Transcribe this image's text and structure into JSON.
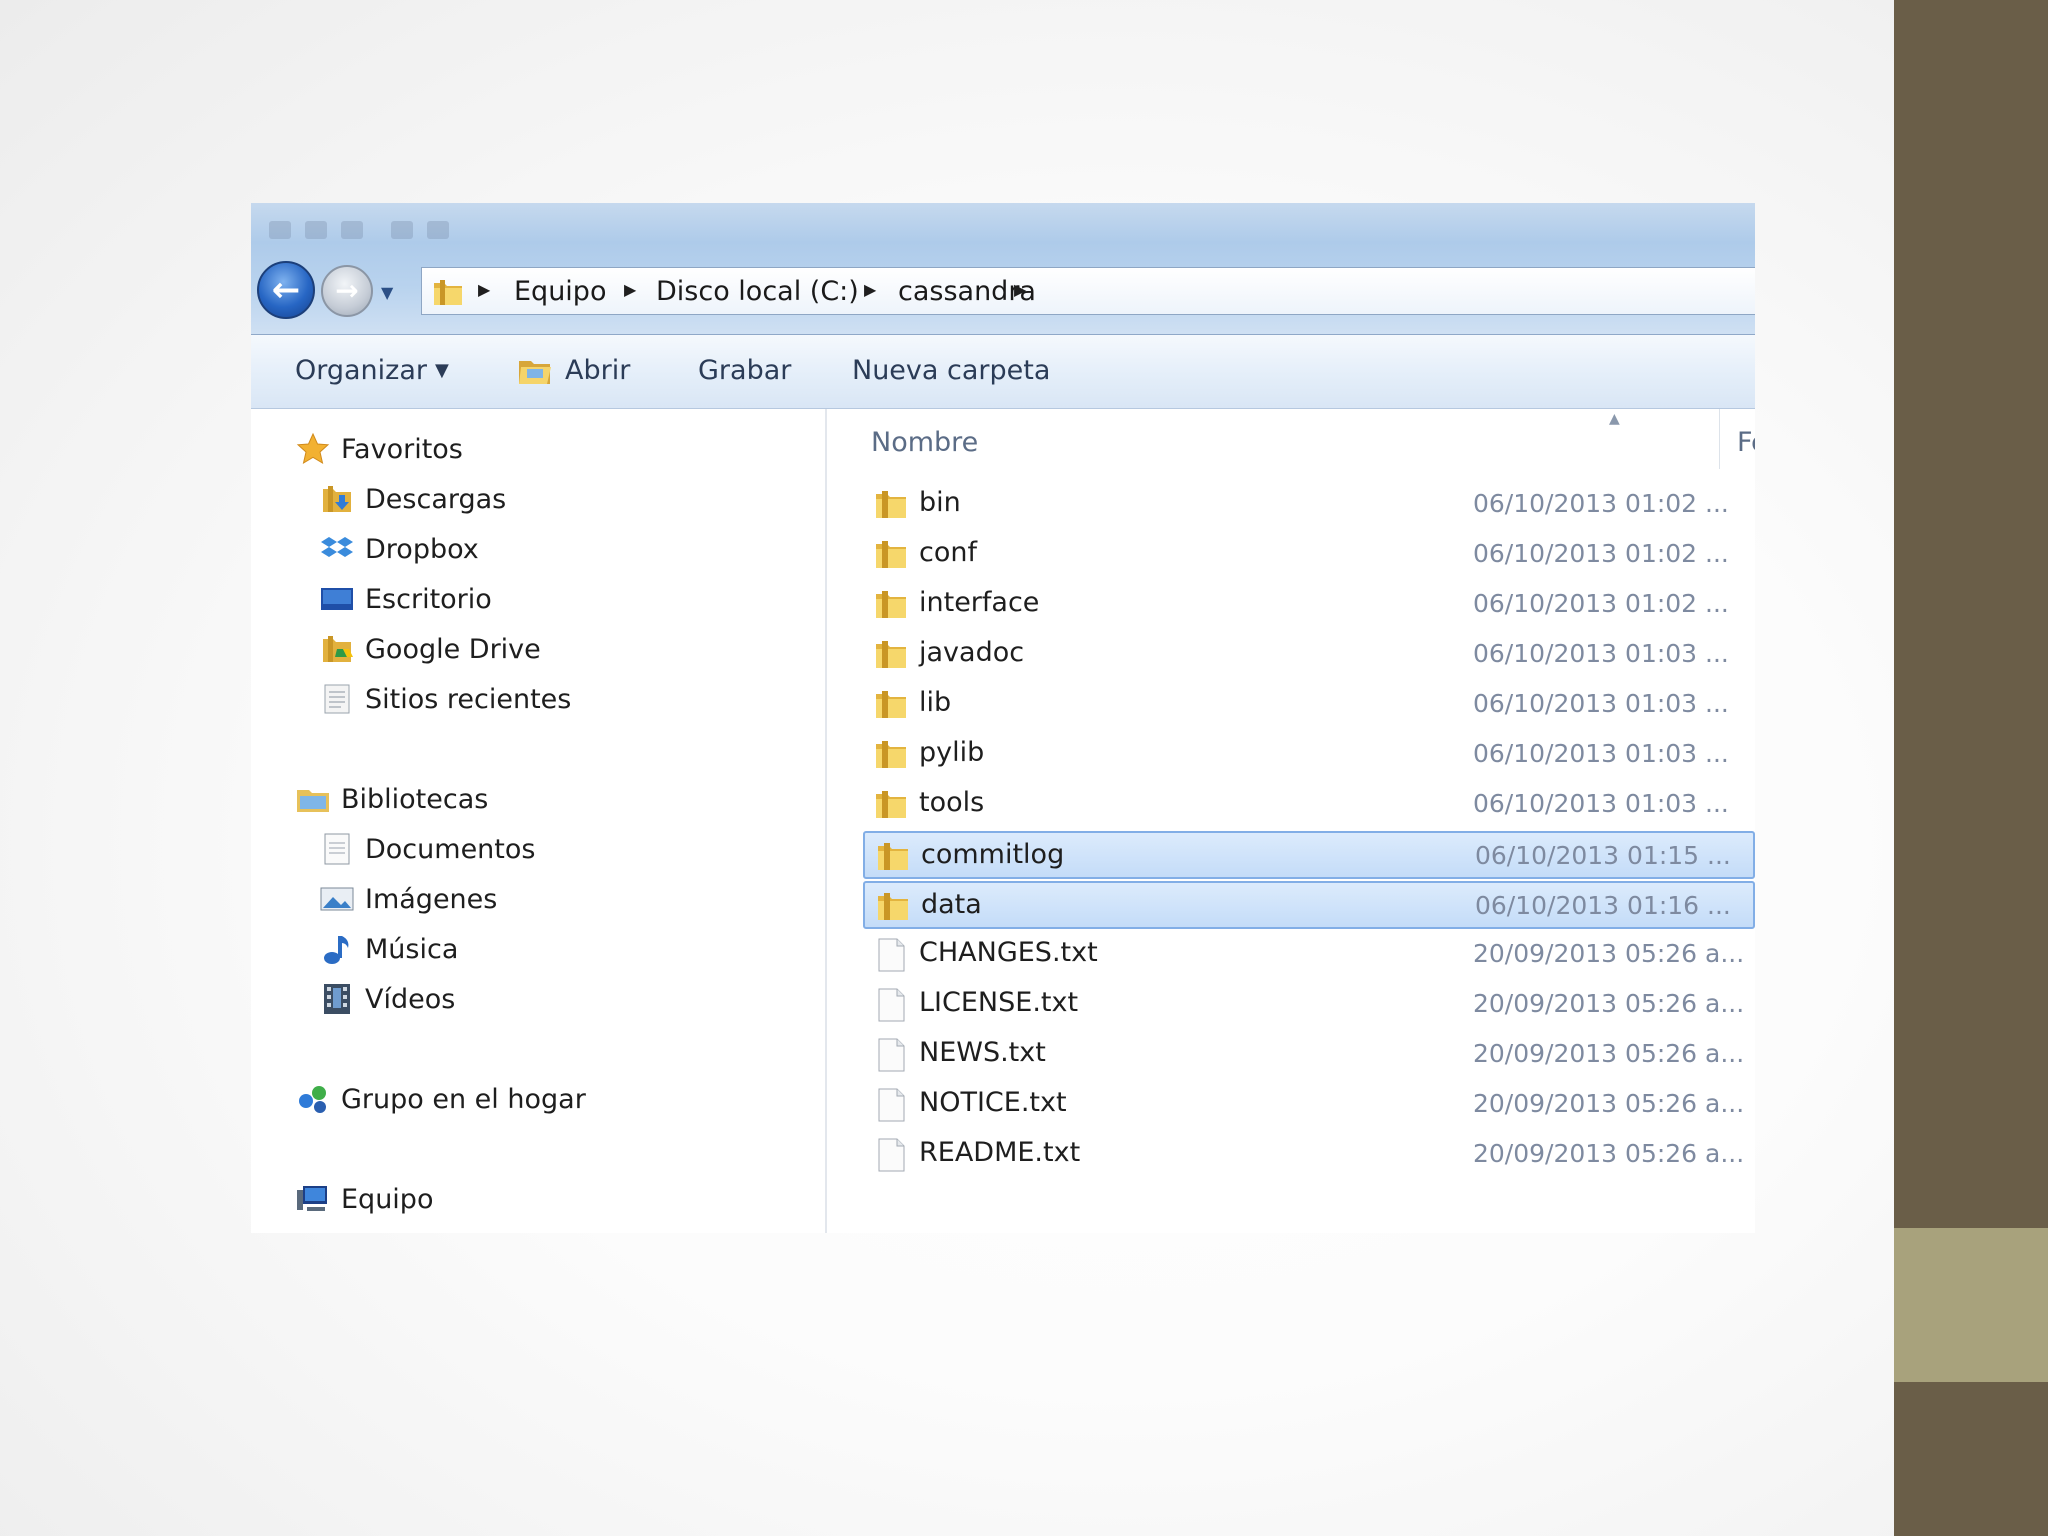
{
  "colors": {
    "selection_fill": "#cfe3fa",
    "selection_border": "#82aee6",
    "slide_bar": "#6a5e48",
    "slide_bar_accent": "#a8a27c"
  },
  "addressbar": {
    "crumbs": [
      "Equipo",
      "Disco local (C:)",
      "cassandra"
    ]
  },
  "toolbar": {
    "organize_label": "Organizar",
    "open_label": "Abrir",
    "burn_label": "Grabar",
    "new_folder_label": "Nueva carpeta"
  },
  "navpane": {
    "favorites": {
      "label": "Favoritos",
      "icon": "star-icon",
      "items": [
        {
          "label": "Descargas",
          "icon": "downloads-icon"
        },
        {
          "label": "Dropbox",
          "icon": "dropbox-icon"
        },
        {
          "label": "Escritorio",
          "icon": "desktop-icon"
        },
        {
          "label": "Google Drive",
          "icon": "google-drive-icon"
        },
        {
          "label": "Sitios recientes",
          "icon": "recent-places-icon"
        }
      ]
    },
    "libraries": {
      "label": "Bibliotecas",
      "icon": "libraries-icon",
      "items": [
        {
          "label": "Documentos",
          "icon": "documents-icon"
        },
        {
          "label": "Imágenes",
          "icon": "pictures-icon"
        },
        {
          "label": "Música",
          "icon": "music-icon"
        },
        {
          "label": "Vídeos",
          "icon": "videos-icon"
        }
      ]
    },
    "homegroup": {
      "label": "Grupo en el hogar",
      "icon": "homegroup-icon"
    },
    "computer": {
      "label": "Equipo",
      "icon": "computer-icon"
    }
  },
  "filelist": {
    "columns": {
      "name": "Nombre",
      "date": "Fecha de modifica..."
    },
    "files": [
      {
        "name": "bin",
        "date": "06/10/2013 01:02 ...",
        "type": "folder",
        "selected": false
      },
      {
        "name": "conf",
        "date": "06/10/2013 01:02 ...",
        "type": "folder",
        "selected": false
      },
      {
        "name": "interface",
        "date": "06/10/2013 01:02 ...",
        "type": "folder",
        "selected": false
      },
      {
        "name": "javadoc",
        "date": "06/10/2013 01:03 ...",
        "type": "folder",
        "selected": false
      },
      {
        "name": "lib",
        "date": "06/10/2013 01:03 ...",
        "type": "folder",
        "selected": false
      },
      {
        "name": "pylib",
        "date": "06/10/2013 01:03 ...",
        "type": "folder",
        "selected": false
      },
      {
        "name": "tools",
        "date": "06/10/2013 01:03 ...",
        "type": "folder",
        "selected": false
      },
      {
        "name": "commitlog",
        "date": "06/10/2013 01:15 ...",
        "type": "folder",
        "selected": true
      },
      {
        "name": "data",
        "date": "06/10/2013 01:16 ...",
        "type": "folder",
        "selected": true
      },
      {
        "name": "CHANGES.txt",
        "date": "20/09/2013 05:26 a...",
        "type": "text",
        "selected": false
      },
      {
        "name": "LICENSE.txt",
        "date": "20/09/2013 05:26 a...",
        "type": "text",
        "selected": false
      },
      {
        "name": "NEWS.txt",
        "date": "20/09/2013 05:26 a...",
        "type": "text",
        "selected": false
      },
      {
        "name": "NOTICE.txt",
        "date": "20/09/2013 05:26 a...",
        "type": "text",
        "selected": false
      },
      {
        "name": "README.txt",
        "date": "20/09/2013 05:26 a...",
        "type": "text",
        "selected": false
      }
    ]
  }
}
